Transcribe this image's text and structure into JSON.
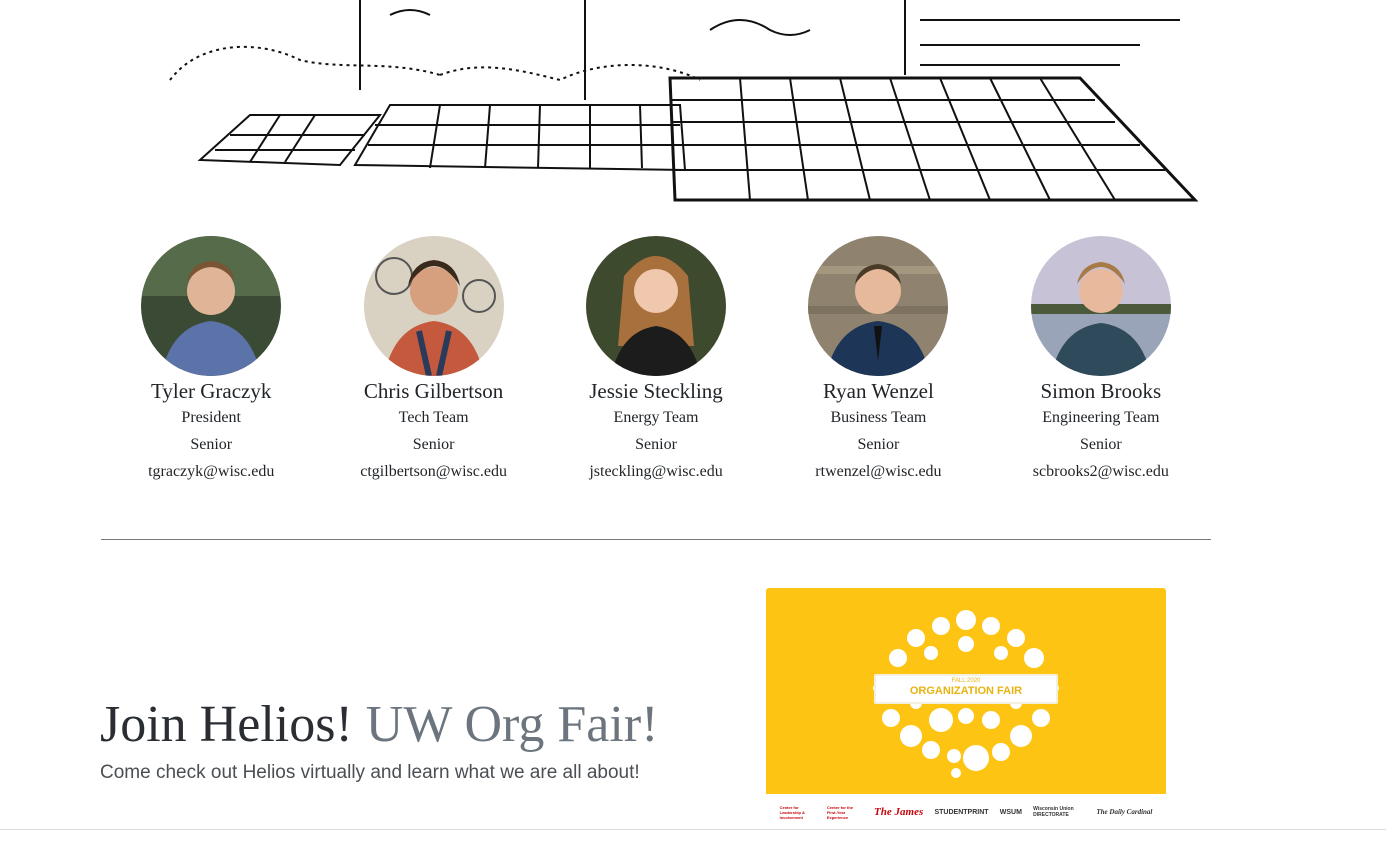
{
  "members": [
    {
      "name": "Tyler Graczyk",
      "role": "President",
      "year": "Senior",
      "email": "tgraczyk@wisc.edu"
    },
    {
      "name": "Chris Gilbertson",
      "role": "Tech Team",
      "year": "Senior",
      "email": "ctgilbertson@wisc.edu"
    },
    {
      "name": "Jessie Steckling",
      "role": "Energy Team",
      "year": "Senior",
      "email": "jsteckling@wisc.edu"
    },
    {
      "name": "Ryan Wenzel",
      "role": "Business Team",
      "year": "Senior",
      "email": "rtwenzel@wisc.edu"
    },
    {
      "name": "Simon Brooks",
      "role": "Engineering Team",
      "year": "Senior",
      "email": "scbrooks2@wisc.edu"
    }
  ],
  "join": {
    "title": "Join Helios!",
    "title_muted": "UW Org Fair!",
    "subtitle": "Come check out Helios virtually and learn what we are all about!"
  },
  "fair": {
    "small": "FALL 2020",
    "big": "ORGANIZATION FAIR",
    "logos": [
      "Center for Leadership & Involvement",
      "Center for the First-Year Experience",
      "The James",
      "STUDENTPRINT",
      "WSUM",
      "Wisconsin Union DIRECTORATE",
      "The Daily Cardinal"
    ]
  },
  "colors": {
    "fair_yellow": "#fec414",
    "muted_text": "#6c757d"
  }
}
